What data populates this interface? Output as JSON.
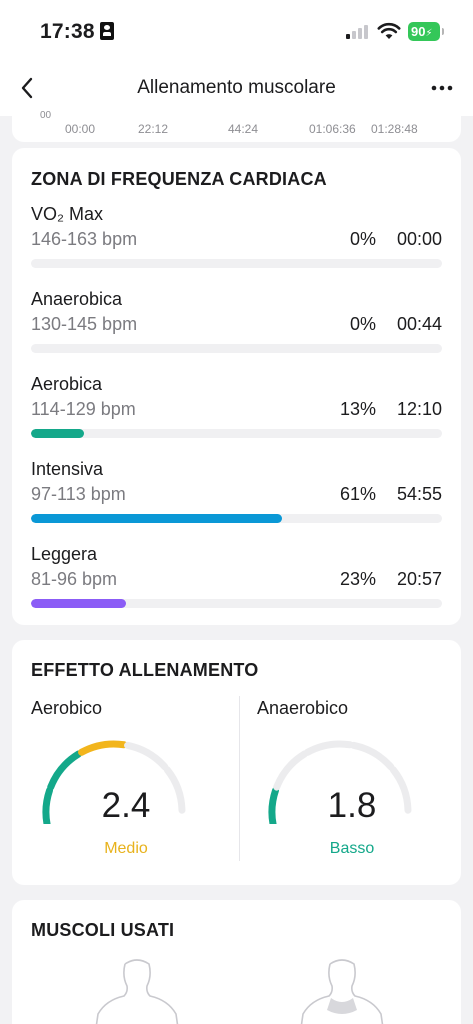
{
  "status_bar": {
    "time": "17:38",
    "battery": "90"
  },
  "nav": {
    "title": "Allenamento muscolare"
  },
  "chart_stub": {
    "ytick": "00",
    "xticks": [
      "00:00",
      "22:12",
      "44:24",
      "01:06:36",
      "01:28:48"
    ]
  },
  "hr_zones": {
    "title": "ZONA DI FREQUENZA CARDIACA",
    "zones": [
      {
        "name": "VO₂ Max",
        "range": "146-163 bpm",
        "percent": "0%",
        "duration": "00:00",
        "fraction": 0,
        "color": "#f0f0f2"
      },
      {
        "name": "Anaerobica",
        "range": "130-145 bpm",
        "percent": "0%",
        "duration": "00:44",
        "fraction": 0,
        "color": "#f0f0f2"
      },
      {
        "name": "Aerobica",
        "range": "114-129 bpm",
        "percent": "13%",
        "duration": "12:10",
        "fraction": 0.13,
        "color": "#14a88a"
      },
      {
        "name": "Intensiva",
        "range": "97-113 bpm",
        "percent": "61%",
        "duration": "54:55",
        "fraction": 0.61,
        "color": "#0a98d6"
      },
      {
        "name": "Leggera",
        "range": "81-96 bpm",
        "percent": "23%",
        "duration": "20:57",
        "fraction": 0.23,
        "color": "#8b5cf6"
      }
    ]
  },
  "training_effect": {
    "title": "EFFETTO ALLENAMENTO",
    "aerobic": {
      "label": "Aerobico",
      "value": "2.4",
      "level": "Medio",
      "level_color": "#e8b21c",
      "fraction": 0.48
    },
    "anaerobic": {
      "label": "Anaerobico",
      "value": "1.8",
      "level": "Basso",
      "level_color": "#14a88a",
      "fraction": 0.36
    }
  },
  "muscles": {
    "title": "MUSCOLI USATI"
  },
  "colors": {
    "accent_green": "#14a88a",
    "accent_blue": "#0a98d6",
    "accent_yellow": "#f2b51c",
    "track": "#ececee"
  }
}
